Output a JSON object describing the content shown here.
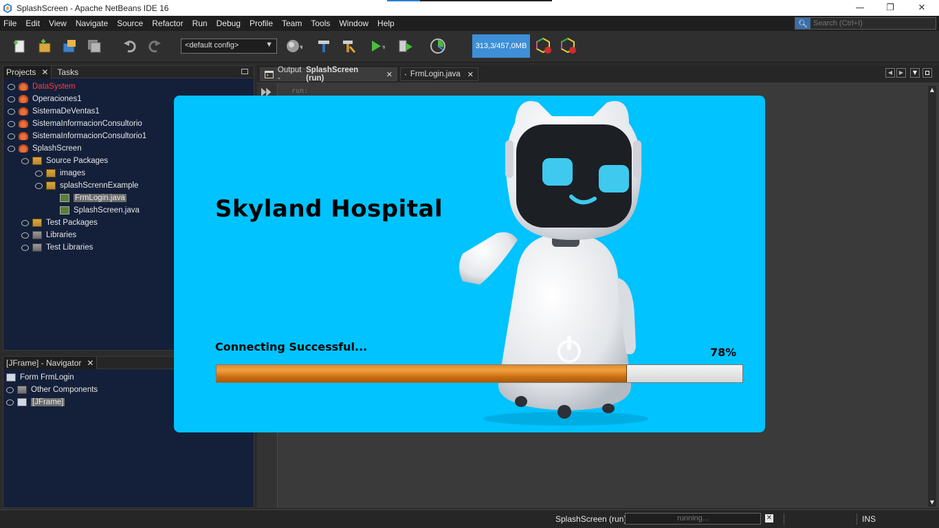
{
  "window": {
    "title": "SplashScreen - Apache NetBeans IDE 16",
    "minimize": "—",
    "restore": "❐",
    "close": "✕"
  },
  "menu": [
    "File",
    "Edit",
    "View",
    "Navigate",
    "Source",
    "Refactor",
    "Run",
    "Debug",
    "Profile",
    "Team",
    "Tools",
    "Window",
    "Help"
  ],
  "search": {
    "placeholder": "Search (Ctrl+I)"
  },
  "toolbar": {
    "config": "<default config>",
    "memory": "313,3/457,0MB"
  },
  "projects_panel": {
    "tabs": [
      "Projects",
      "Tasks"
    ],
    "tree": [
      {
        "label": "DataSystem",
        "icon": "project-icon",
        "level": 0,
        "highlight": "error"
      },
      {
        "label": "Operaciones1",
        "icon": "project-icon",
        "level": 0
      },
      {
        "label": "SistemaDeVentas1",
        "icon": "project-icon",
        "level": 0
      },
      {
        "label": "SistemaInformacionConsultorio",
        "icon": "project-icon",
        "level": 0
      },
      {
        "label": "SistemaInformacionConsultorio1",
        "icon": "project-icon",
        "level": 0
      },
      {
        "label": "SplashScreen",
        "icon": "project-icon",
        "level": 0
      },
      {
        "label": "Source Packages",
        "icon": "package-folder-icon",
        "level": 1
      },
      {
        "label": "images",
        "icon": "package-icon",
        "level": 2
      },
      {
        "label": "splashScrennExample",
        "icon": "package-icon",
        "level": 2
      },
      {
        "label": "FrmLogin.java",
        "icon": "java-file-icon",
        "level": 3,
        "selected": true
      },
      {
        "label": "SplashScreen.java",
        "icon": "java-file-icon",
        "level": 3
      },
      {
        "label": "Test Packages",
        "icon": "package-folder-icon",
        "level": 1
      },
      {
        "label": "Libraries",
        "icon": "library-icon",
        "level": 1
      },
      {
        "label": "Test Libraries",
        "icon": "library-icon",
        "level": 1
      }
    ]
  },
  "navigator_panel": {
    "title": "[JFrame] - Navigator",
    "tree": [
      {
        "label": "Form FrmLogin",
        "icon": "form-icon"
      },
      {
        "label": "Other Components",
        "icon": "components-icon"
      },
      {
        "label": "[JFrame]",
        "icon": "jframe-icon",
        "selected": true
      }
    ]
  },
  "editor": {
    "tabs": [
      {
        "label_prefix": "Output - ",
        "label_bold": "SplashScreen (run)",
        "active": true
      },
      {
        "label": "FrmLogin.java"
      }
    ],
    "output_line": "run:"
  },
  "splash": {
    "title": "Skyland Hospital",
    "status": "Connecting Successful...",
    "percent_text": "78%",
    "progress": 0.78,
    "background_color": "#00c3ff"
  },
  "statusbar": {
    "task": "SplashScreen (run)",
    "progress_text": "running...",
    "mode": "INS"
  }
}
